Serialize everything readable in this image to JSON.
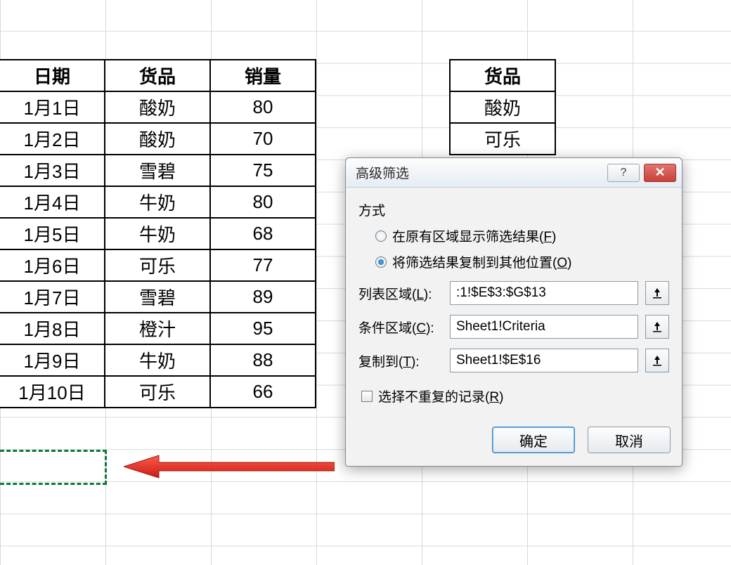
{
  "main_table": {
    "headers": [
      "日期",
      "货品",
      "销量"
    ],
    "rows": [
      [
        "1月1日",
        "酸奶",
        "80"
      ],
      [
        "1月2日",
        "酸奶",
        "70"
      ],
      [
        "1月3日",
        "雪碧",
        "75"
      ],
      [
        "1月4日",
        "牛奶",
        "80"
      ],
      [
        "1月5日",
        "牛奶",
        "68"
      ],
      [
        "1月6日",
        "可乐",
        "77"
      ],
      [
        "1月7日",
        "雪碧",
        "89"
      ],
      [
        "1月8日",
        "橙汁",
        "95"
      ],
      [
        "1月9日",
        "牛奶",
        "88"
      ],
      [
        "1月10日",
        "可乐",
        "66"
      ]
    ]
  },
  "criteria_table": {
    "header": "货品",
    "rows": [
      "酸奶",
      "可乐"
    ]
  },
  "dialog": {
    "title": "高级筛选",
    "help_symbol": "?",
    "close_symbol": "✕",
    "method_label": "方式",
    "radio_inplace": "在原有区域显示筛选结果(",
    "radio_inplace_key": "F",
    "radio_inplace_suffix": ")",
    "radio_copy": "将筛选结果复制到其他位置(",
    "radio_copy_key": "O",
    "radio_copy_suffix": ")",
    "list_label": "列表区域(",
    "list_key": "L",
    "list_suffix": "):",
    "list_value": ":1!$E$3:$G$13",
    "crit_label": "条件区域(",
    "crit_key": "C",
    "crit_suffix": "):",
    "crit_value": "Sheet1!Criteria",
    "copy_label": "复制到(",
    "copy_key": "T",
    "copy_suffix": "):",
    "copy_value": "Sheet1!$E$16",
    "unique_label": "选择不重复的记录(",
    "unique_key": "R",
    "unique_suffix": ")",
    "ok": "确定",
    "cancel": "取消"
  }
}
